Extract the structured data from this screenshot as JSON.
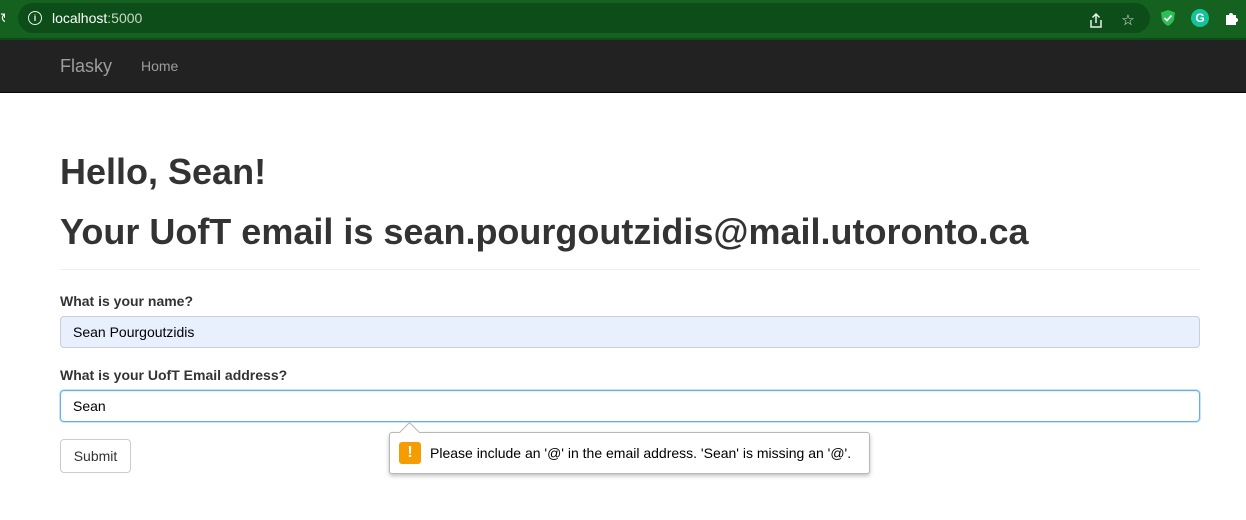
{
  "browser": {
    "url_host": "localhost",
    "url_port": ":5000"
  },
  "navbar": {
    "brand": "Flasky",
    "home": "Home"
  },
  "page": {
    "greeting": "Hello, Sean!",
    "email_heading": "Your UofT email is sean.pourgoutzidis@mail.utoronto.ca"
  },
  "form": {
    "name_label": "What is your name?",
    "name_value": "Sean Pourgoutzidis",
    "email_label": "What is your UofT Email address?",
    "email_value": "Sean",
    "submit_label": "Submit"
  },
  "validation": {
    "message": "Please include an '@' in the email address. 'Sean' is missing an '@'.",
    "icon": "warning-icon",
    "icon_color": "#f59c00"
  },
  "colors": {
    "chrome_bg": "#15611f",
    "navbar_bg": "#222222",
    "focus_border": "#66afe9",
    "autofill_bg": "#e8f0fe"
  }
}
